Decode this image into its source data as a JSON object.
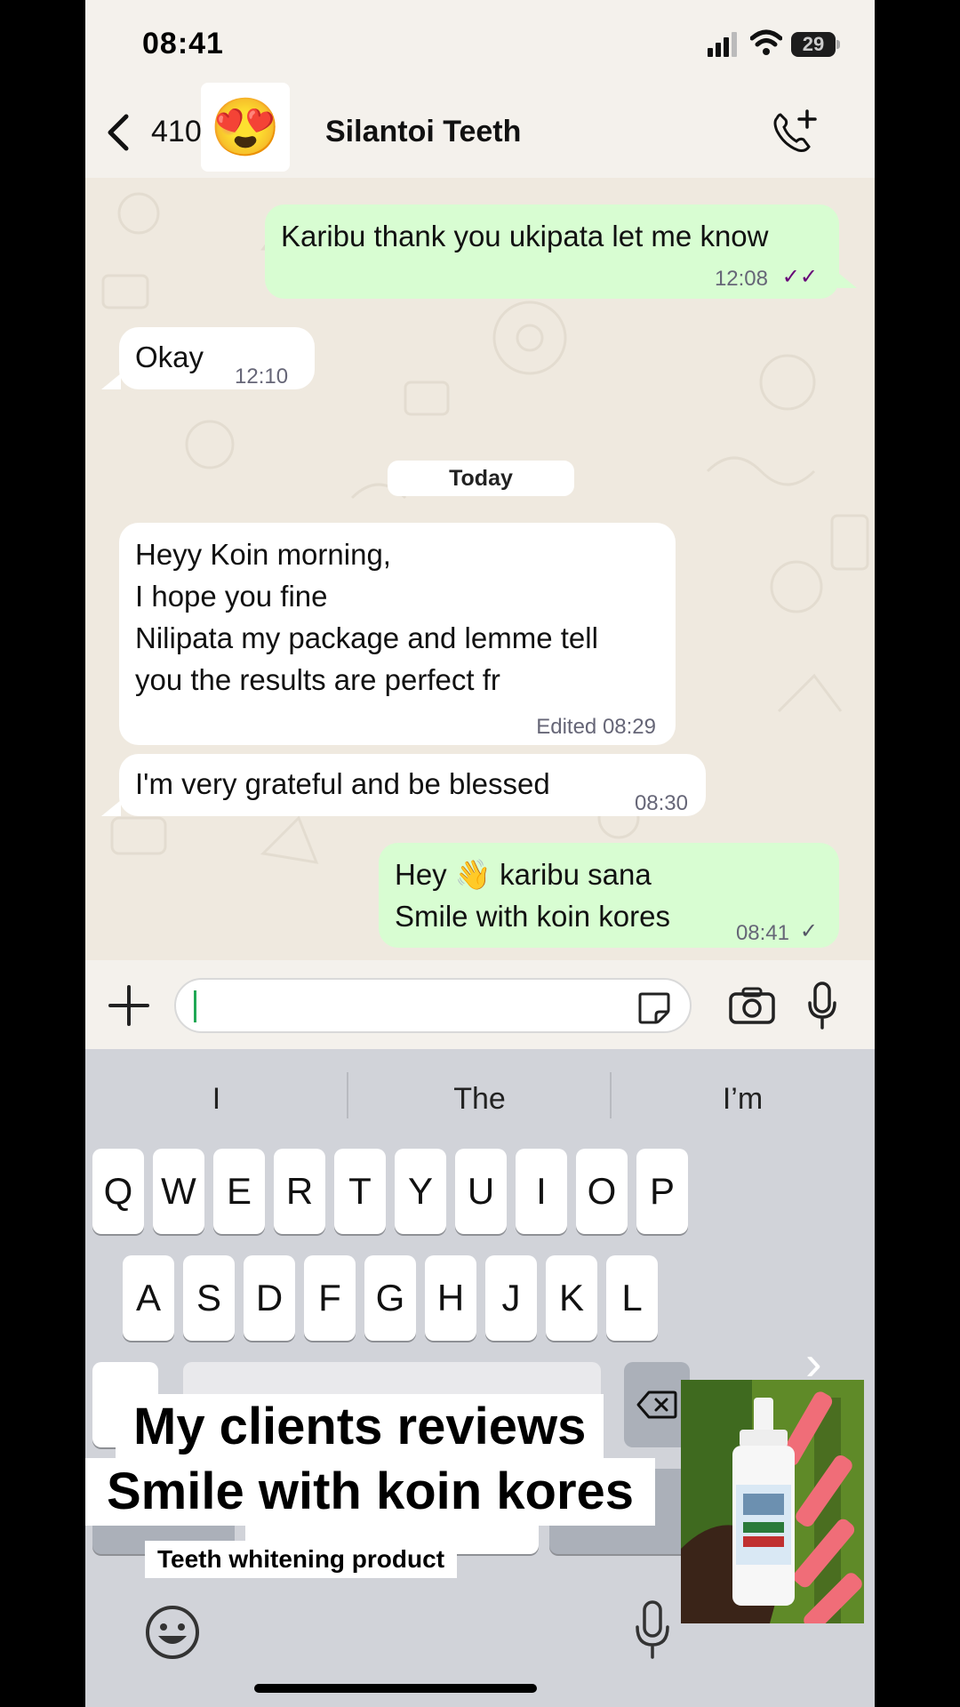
{
  "status": {
    "time": "08:41",
    "battery": "29"
  },
  "header": {
    "back_count": "410",
    "avatar_emoji": "😍",
    "contact_name": "Silantoi Teeth"
  },
  "messages": [
    {
      "dir": "out",
      "text": "Karibu thank you ukipata let me know",
      "time": "12:08",
      "ticks": "✓✓"
    },
    {
      "dir": "in",
      "text": "Okay",
      "time": "12:10"
    },
    {
      "dir": "in",
      "lines": [
        "Heyy Koin morning,",
        "I hope you fine",
        "Nilipata my package and lemme tell",
        "you the results are perfect fr"
      ],
      "time": "Edited 08:29"
    },
    {
      "dir": "in",
      "text": "I'm very grateful and be blessed",
      "time": "08:30"
    },
    {
      "dir": "out",
      "lines": [
        "Hey 👋 karibu sana",
        "Smile with koin kores"
      ],
      "time": "08:41",
      "ticks": "✓"
    }
  ],
  "day_label": "Today",
  "keyboard": {
    "suggestions": [
      "I",
      "The",
      "I’m"
    ],
    "row1": [
      "Q",
      "W",
      "E",
      "R",
      "T",
      "Y",
      "U",
      "I",
      "O",
      "P"
    ],
    "row2": [
      "A",
      "S",
      "D",
      "F",
      "G",
      "H",
      "J",
      "K",
      "L"
    ]
  },
  "overlay": {
    "line1": "My clients reviews",
    "line2": "Smile with koin kores",
    "line3": "Teeth whitening product"
  }
}
